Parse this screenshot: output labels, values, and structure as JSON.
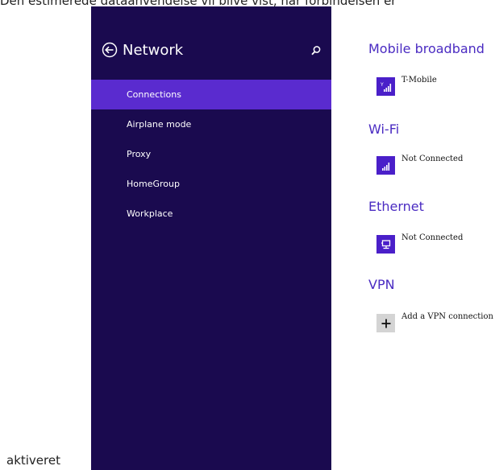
{
  "document": {
    "text_top": "Den estimerede dataanvendelse vil blive vist, når forbindelsen er",
    "text_bottom": "aktiveret"
  },
  "pane": {
    "title": "Network",
    "back_icon": "back-arrow-circle-icon",
    "search_icon": "search-icon",
    "background": "#1a0a4f",
    "nav_items": [
      {
        "label": "Connections",
        "active": true
      },
      {
        "label": "Airplane mode",
        "active": false
      },
      {
        "label": "Proxy",
        "active": false
      },
      {
        "label": "HomeGroup",
        "active": false
      },
      {
        "label": "Workplace",
        "active": false
      }
    ],
    "active_color": "#5a2bcf"
  },
  "content": {
    "accent": "#4a2bc2",
    "sections": [
      {
        "title": "Mobile broadband",
        "item": "T-Mobile",
        "icon": "mobile-signal-icon"
      },
      {
        "title": "Wi-Fi",
        "item": "Not Connected",
        "icon": "wifi-signal-icon"
      },
      {
        "title": "Ethernet",
        "item": "Not Connected",
        "icon": "ethernet-icon"
      },
      {
        "title": "VPN",
        "item": "Add a VPN connection",
        "icon": "plus-icon"
      }
    ]
  }
}
